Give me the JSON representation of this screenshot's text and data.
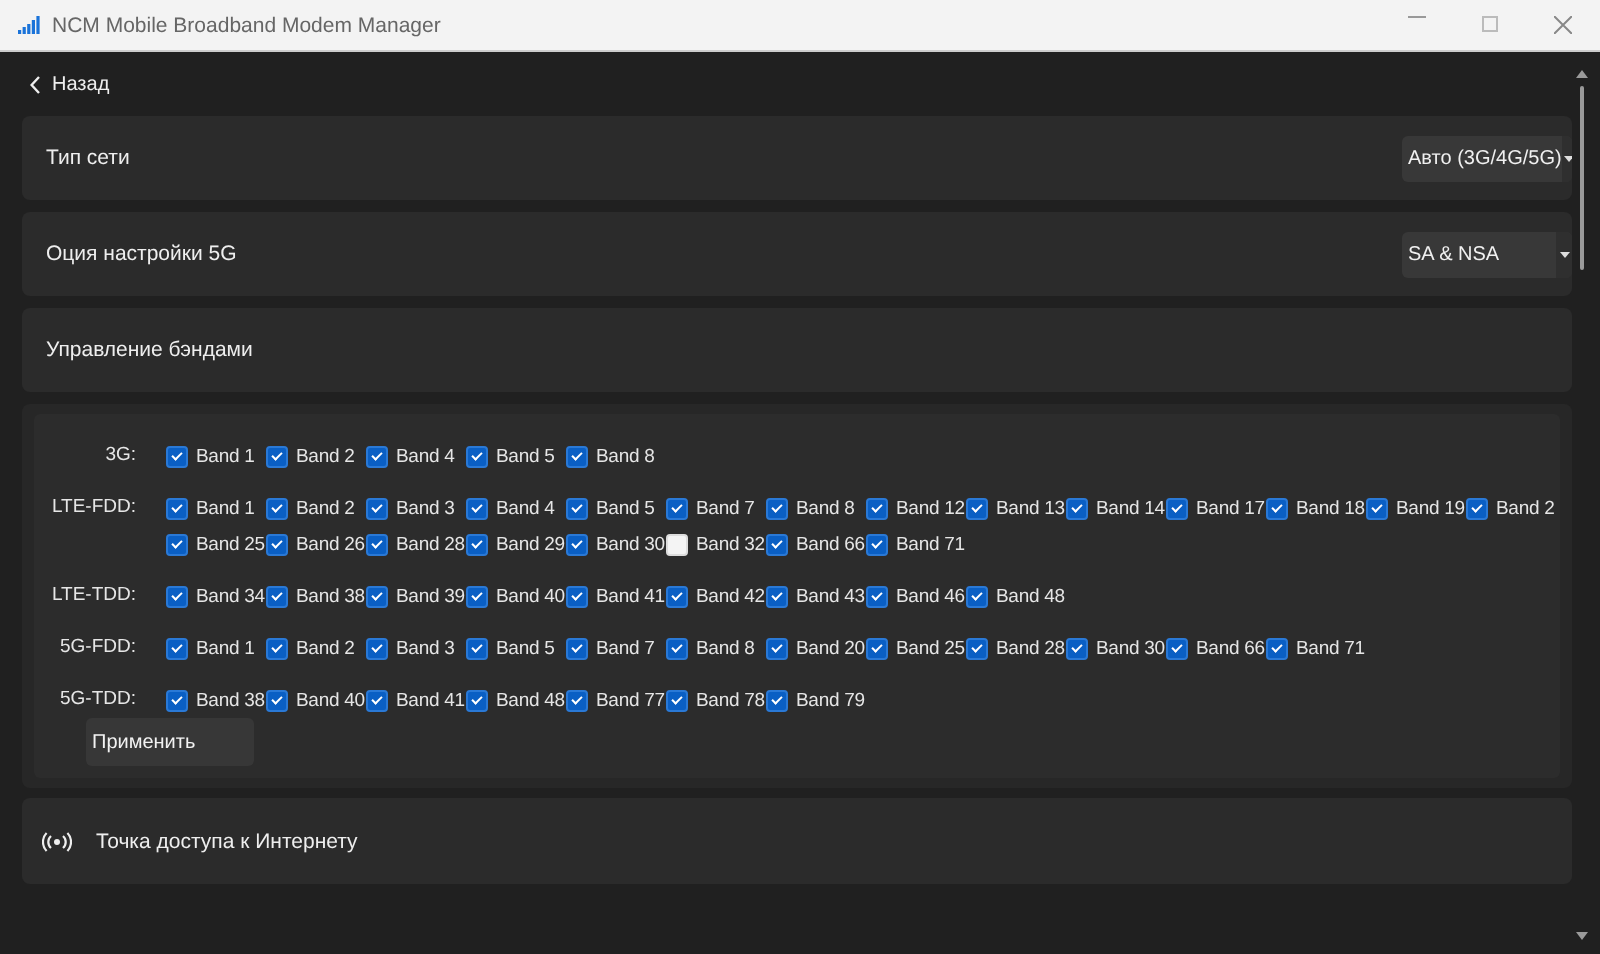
{
  "window": {
    "title": "NCM Mobile Broadband Modem Manager"
  },
  "back": {
    "label": "Назад"
  },
  "settings": [
    {
      "label": "Тип сети",
      "value": "Авто (3G/4G/5G)"
    },
    {
      "label": "Оция настройки 5G",
      "value": "SA & NSA"
    }
  ],
  "band_management": {
    "label": "Управление бэндами",
    "groups": [
      {
        "name": "3G:",
        "bands": [
          {
            "label": "Band 1",
            "checked": true
          },
          {
            "label": "Band 2",
            "checked": true
          },
          {
            "label": "Band 4",
            "checked": true
          },
          {
            "label": "Band 5",
            "checked": true
          },
          {
            "label": "Band 8",
            "checked": true
          }
        ]
      },
      {
        "name": "LTE-FDD:",
        "bands": [
          {
            "label": "Band 1",
            "checked": true
          },
          {
            "label": "Band 2",
            "checked": true
          },
          {
            "label": "Band 3",
            "checked": true
          },
          {
            "label": "Band 4",
            "checked": true
          },
          {
            "label": "Band 5",
            "checked": true
          },
          {
            "label": "Band 7",
            "checked": true
          },
          {
            "label": "Band 8",
            "checked": true
          },
          {
            "label": "Band 12",
            "checked": true
          },
          {
            "label": "Band 13",
            "checked": true
          },
          {
            "label": "Band 14",
            "checked": true
          },
          {
            "label": "Band 17",
            "checked": true
          },
          {
            "label": "Band 18",
            "checked": true
          },
          {
            "label": "Band 19",
            "checked": true
          },
          {
            "label": "Band 2",
            "checked": true
          },
          {
            "label": "Band 25",
            "checked": true
          },
          {
            "label": "Band 26",
            "checked": true
          },
          {
            "label": "Band 28",
            "checked": true
          },
          {
            "label": "Band 29",
            "checked": true
          },
          {
            "label": "Band 30",
            "checked": true
          },
          {
            "label": "Band 32",
            "checked": false
          },
          {
            "label": "Band 66",
            "checked": true
          },
          {
            "label": "Band 71",
            "checked": true
          }
        ]
      },
      {
        "name": "LTE-TDD:",
        "bands": [
          {
            "label": "Band 34",
            "checked": true
          },
          {
            "label": "Band 38",
            "checked": true
          },
          {
            "label": "Band 39",
            "checked": true
          },
          {
            "label": "Band 40",
            "checked": true
          },
          {
            "label": "Band 41",
            "checked": true
          },
          {
            "label": "Band 42",
            "checked": true
          },
          {
            "label": "Band 43",
            "checked": true
          },
          {
            "label": "Band 46",
            "checked": true
          },
          {
            "label": "Band 48",
            "checked": true
          }
        ]
      },
      {
        "name": "5G-FDD:",
        "bands": [
          {
            "label": "Band 1",
            "checked": true
          },
          {
            "label": "Band 2",
            "checked": true
          },
          {
            "label": "Band 3",
            "checked": true
          },
          {
            "label": "Band 5",
            "checked": true
          },
          {
            "label": "Band 7",
            "checked": true
          },
          {
            "label": "Band 8",
            "checked": true
          },
          {
            "label": "Band 20",
            "checked": true
          },
          {
            "label": "Band 25",
            "checked": true
          },
          {
            "label": "Band 28",
            "checked": true
          },
          {
            "label": "Band 30",
            "checked": true
          },
          {
            "label": "Band 66",
            "checked": true
          },
          {
            "label": "Band 71",
            "checked": true
          }
        ]
      },
      {
        "name": "5G-TDD:",
        "bands": [
          {
            "label": "Band 38",
            "checked": true
          },
          {
            "label": "Band 40",
            "checked": true
          },
          {
            "label": "Band 41",
            "checked": true
          },
          {
            "label": "Band 48",
            "checked": true
          },
          {
            "label": "Band 77",
            "checked": true
          },
          {
            "label": "Band 78",
            "checked": true
          },
          {
            "label": "Band 79",
            "checked": true
          }
        ]
      }
    ],
    "apply_button": "Применить"
  },
  "hotspot": {
    "label": "Точка доступа к Интернету"
  }
}
